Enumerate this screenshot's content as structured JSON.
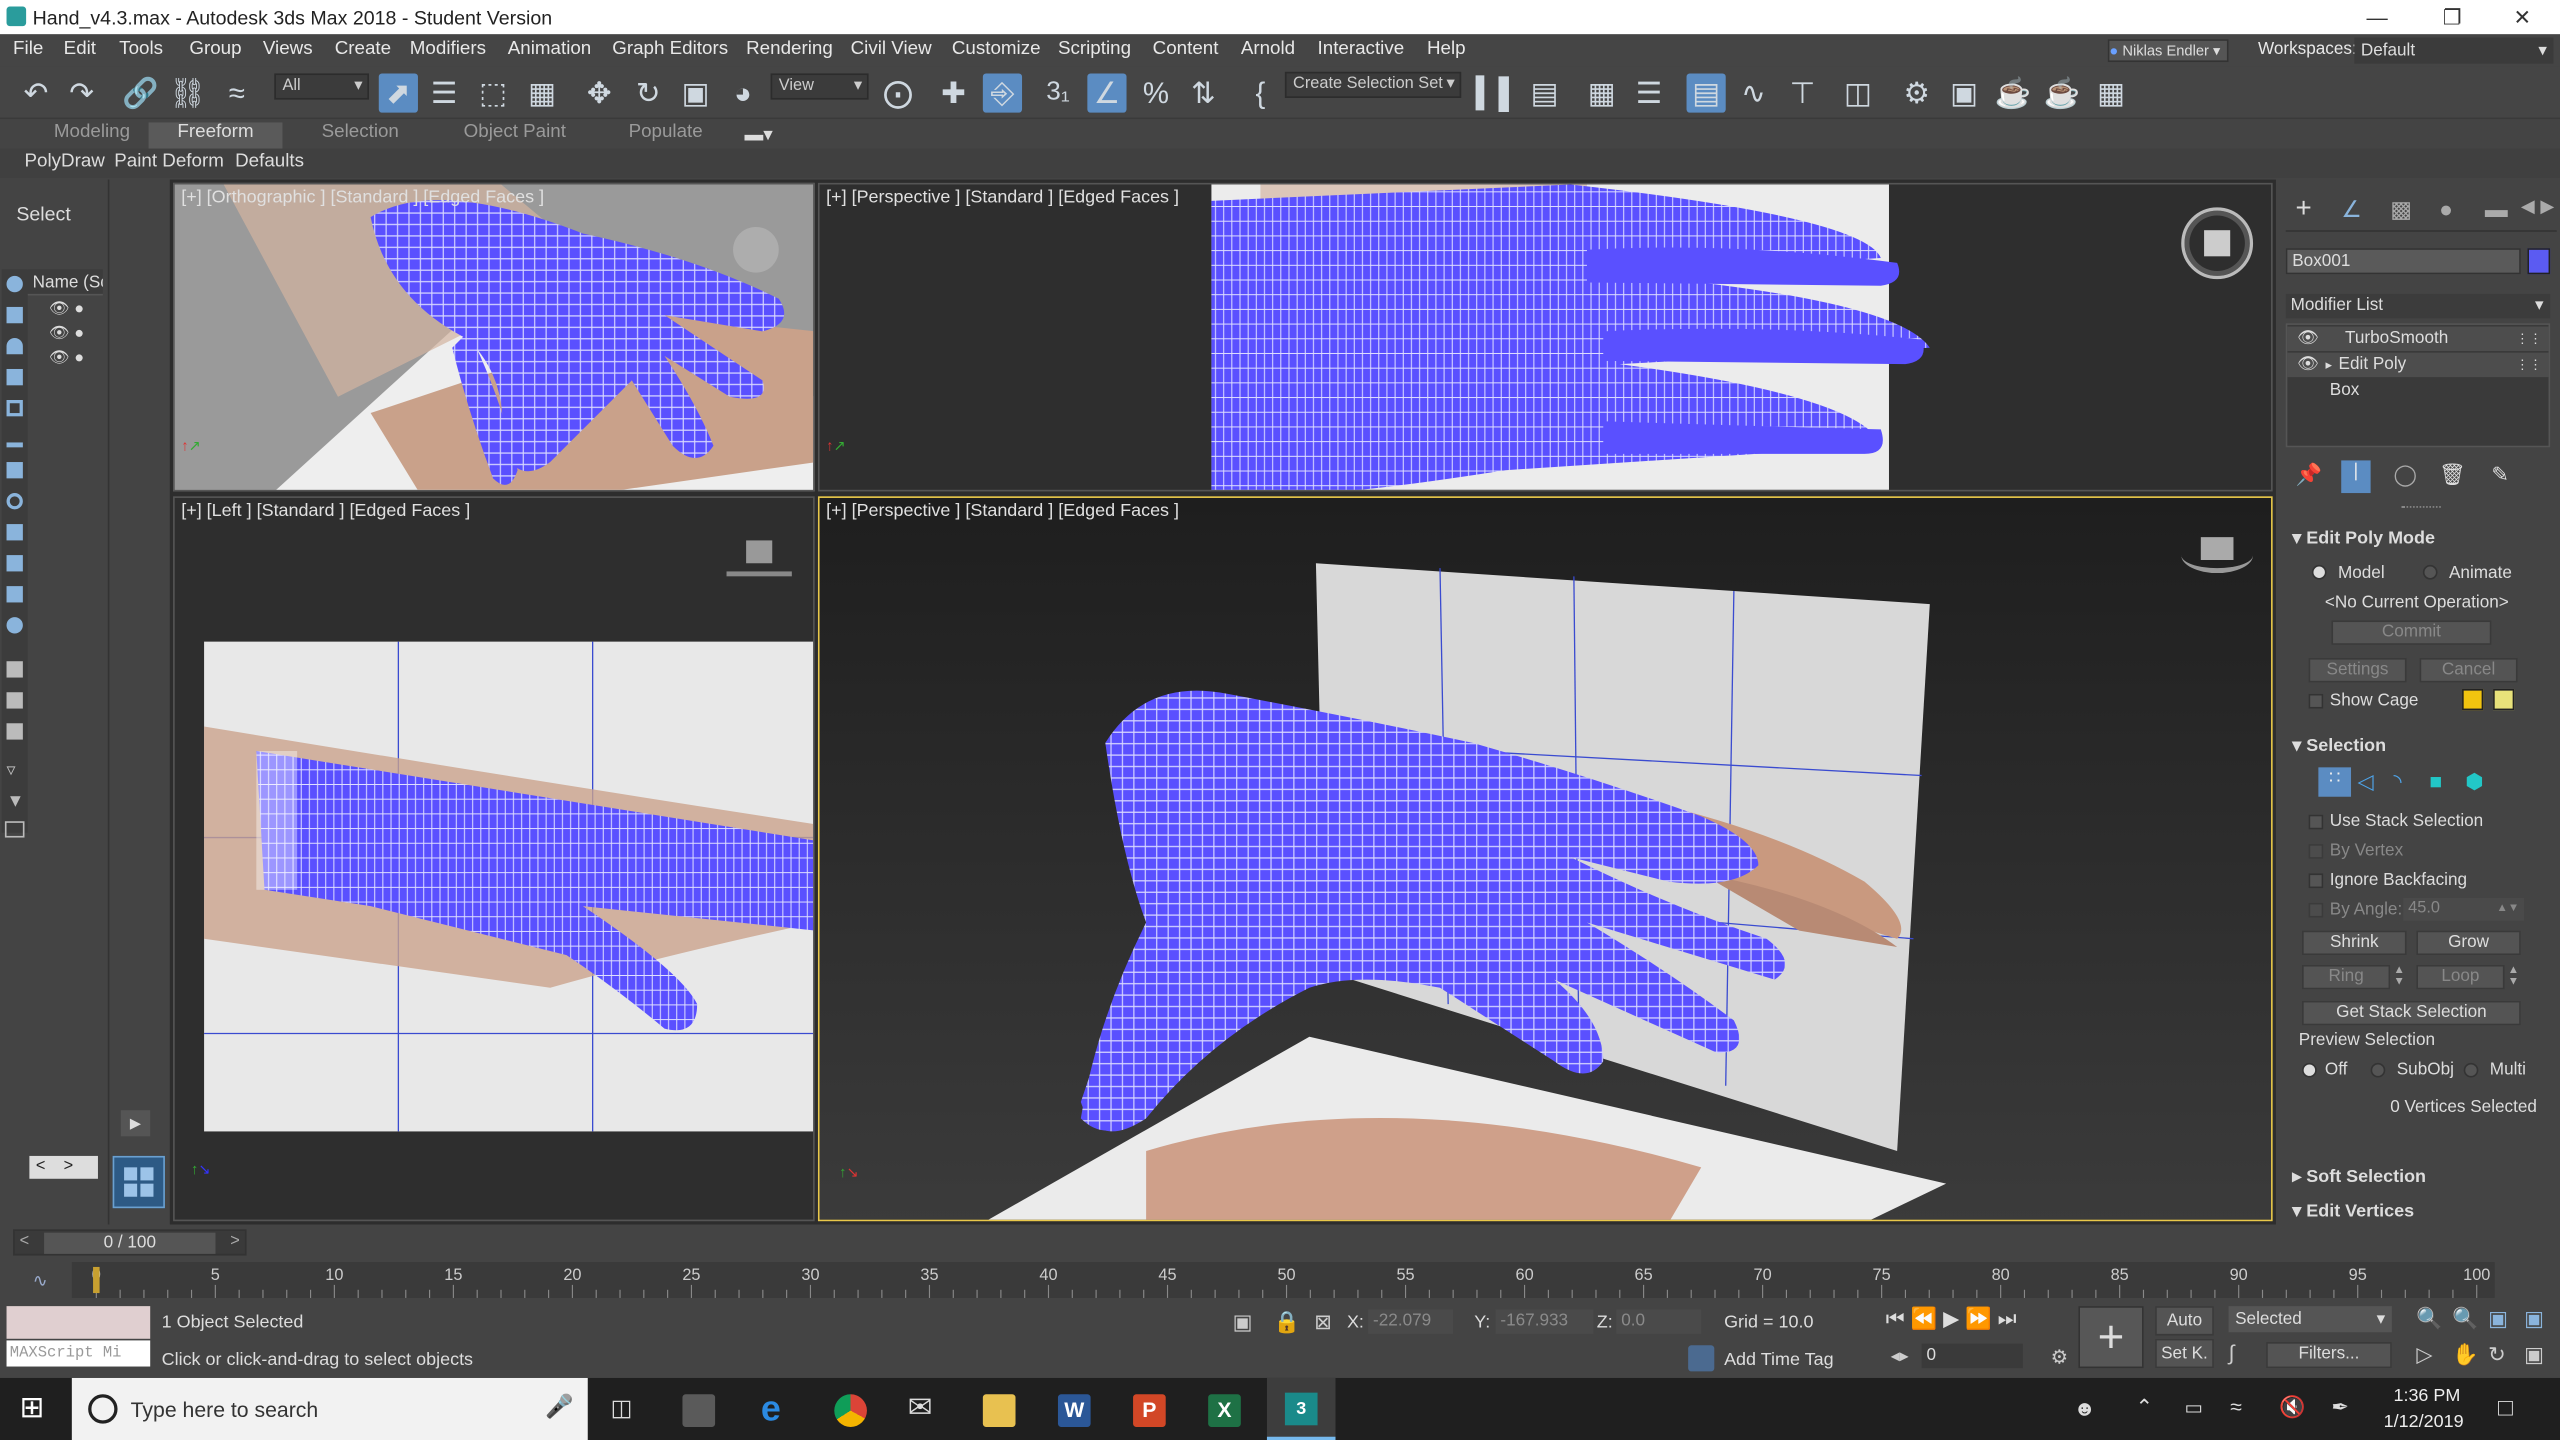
{
  "window": {
    "title": "Hand_v4.3.max - Autodesk 3ds Max 2018 - Student Version"
  },
  "menu": [
    "File",
    "Edit",
    "Tools",
    "Group",
    "Views",
    "Create",
    "Modifiers",
    "Animation",
    "Graph Editors",
    "Rendering",
    "Civil View",
    "Customize",
    "Scripting",
    "Content",
    "Arnold",
    "Interactive",
    "Help"
  ],
  "user": {
    "name": "Niklas Endler"
  },
  "workspaces": {
    "label": "Workspaces:",
    "value": "Default"
  },
  "toolbar": {
    "filter": "All",
    "ref_coord": "View",
    "selection_set": "Create Selection Set",
    "snap_angle": "3"
  },
  "ribbon": {
    "tabs": [
      "Modeling",
      "Freeform",
      "Selection",
      "Object Paint",
      "Populate"
    ],
    "subtabs": [
      "PolyDraw",
      "Paint Deform",
      "Defaults"
    ]
  },
  "scene_explorer": {
    "select_label": "Select",
    "name_header": "Name (Sc"
  },
  "viewports": {
    "top_left": "[+] [Orthographic ] [Standard ] [Edged Faces ]",
    "top_right": "[+] [Perspective ] [Standard ] [Edged Faces ]",
    "bottom_left": "[+] [Left ] [Standard ] [Edged Faces ]",
    "bottom_right": "[+] [Perspective ] [Standard ] [Edged Faces ]"
  },
  "command_panel": {
    "object_name": "Box001",
    "object_color": "#5b5bf2",
    "modifier_list": "Modifier List",
    "stack": [
      "TurboSmooth",
      "Edit Poly",
      "Box"
    ],
    "edit_poly_mode": {
      "title": "Edit Poly Mode",
      "model": "Model",
      "animate": "Animate",
      "operation": "<No Current Operation>",
      "commit": "Commit",
      "settings": "Settings",
      "cancel": "Cancel",
      "show_cage": "Show Cage",
      "cage_colors": [
        "#f1c40f",
        "#e8e27a"
      ]
    },
    "selection": {
      "title": "Selection",
      "use_stack": "Use Stack Selection",
      "by_vertex": "By Vertex",
      "ignore_backfacing": "Ignore Backfacing",
      "by_angle": "By Angle:",
      "angle_value": "45.0",
      "shrink": "Shrink",
      "grow": "Grow",
      "ring": "Ring",
      "loop": "Loop",
      "get_stack": "Get Stack Selection",
      "preview": "Preview Selection",
      "off": "Off",
      "subobj": "SubObj",
      "multi": "Multi",
      "count": "0 Vertices Selected"
    },
    "soft_selection": "Soft Selection",
    "edit_vertices": "Edit Vertices"
  },
  "timeline": {
    "frame": "0 / 100",
    "ticks": [
      "0",
      "5",
      "10",
      "15",
      "20",
      "25",
      "30",
      "35",
      "40",
      "45",
      "50",
      "55",
      "60",
      "65",
      "70",
      "75",
      "80",
      "85",
      "90",
      "95",
      "100"
    ]
  },
  "status": {
    "selected": "1 Object Selected",
    "prompt": "Click or click-and-drag to select objects",
    "maxscript": "MAXScript Mi",
    "x_label": "X:",
    "x": "-22.079",
    "y_label": "Y:",
    "y": "-167.933",
    "z_label": "Z:",
    "z": "0.0",
    "grid": "Grid = 10.0",
    "add_time_tag": "Add Time Tag",
    "auto": "Auto",
    "set_key": "Set K.",
    "selected_dd": "Selected",
    "filters": "Filters...",
    "frame_field": "0"
  },
  "taskbar": {
    "search": "Type here to search",
    "time": "1:36 PM",
    "date": "1/12/2019"
  },
  "colors": {
    "mesh": "#5a50ff",
    "active_border": "#e9c84a"
  }
}
